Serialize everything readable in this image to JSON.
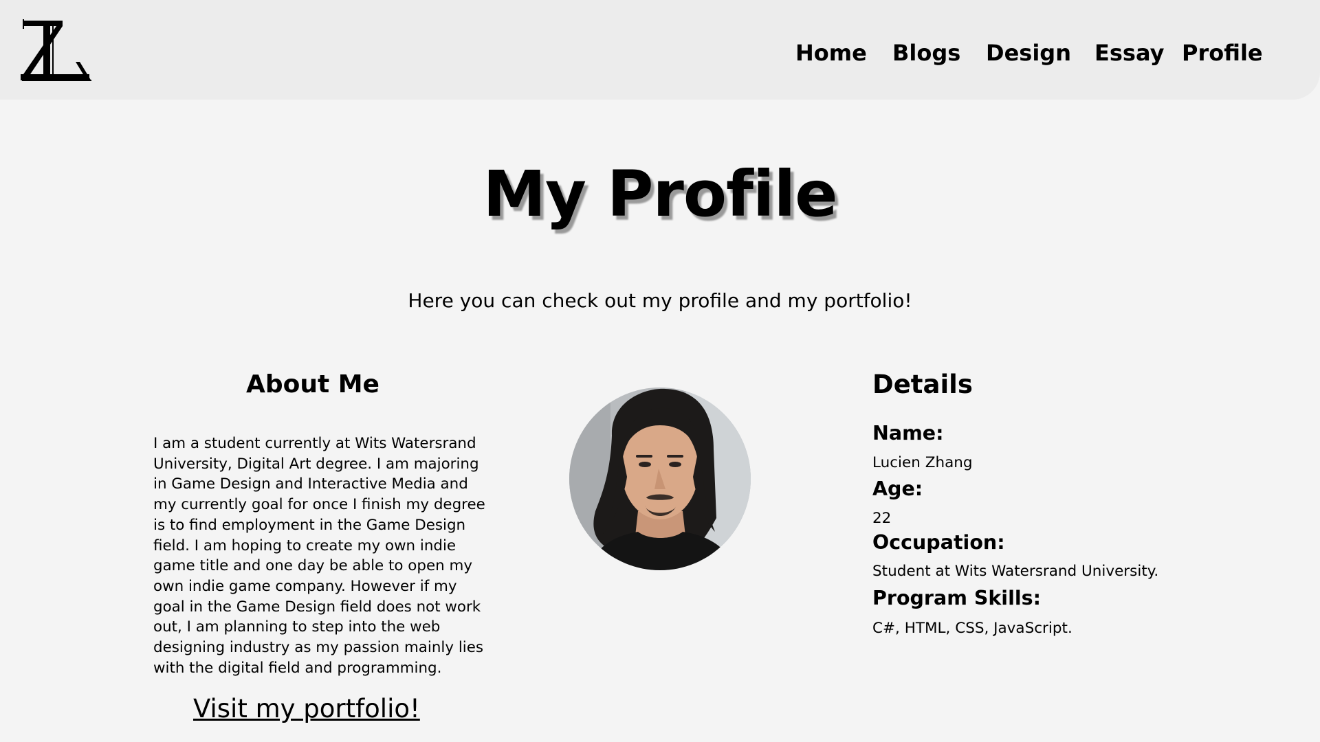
{
  "header": {
    "logo_text": "ZL",
    "nav": [
      {
        "label": "Home"
      },
      {
        "label": "Blogs"
      },
      {
        "label": "Design"
      },
      {
        "label": "Essay"
      },
      {
        "label": "Profile"
      }
    ]
  },
  "main": {
    "title": "My Profile",
    "subtitle": "Here you can check out my profile and my portfolio!",
    "about": {
      "heading": "About Me",
      "body": "I am a student currently at Wits Watersrand University, Digital Art degree. I am majoring in Game Design and Interactive Media and my currently goal for once I finish my degree is to find employment in the Game Design field. I am hoping to create my own indie game title and one day be able to open my own indie game company. However if my goal in the Game Design field does not work out, I am planning to step into the web designing industry as my passion mainly lies with the digital field and programming.",
      "link_label": "Visit my portfolio!"
    },
    "details": {
      "heading": "Details",
      "name_label": "Name:",
      "name_value": "Lucien Zhang",
      "age_label": "Age:",
      "age_value": "22",
      "occupation_label": "Occupation:",
      "occupation_value": "Student at Wits Watersrand University.",
      "skills_label": "Program Skills:",
      "skills_value": "C#, HTML, CSS, JavaScript."
    }
  },
  "colors": {
    "page_background": "#f4f4f4",
    "header_background": "#ececec",
    "text": "#000000",
    "title_shadow": "#9a9a9a"
  }
}
